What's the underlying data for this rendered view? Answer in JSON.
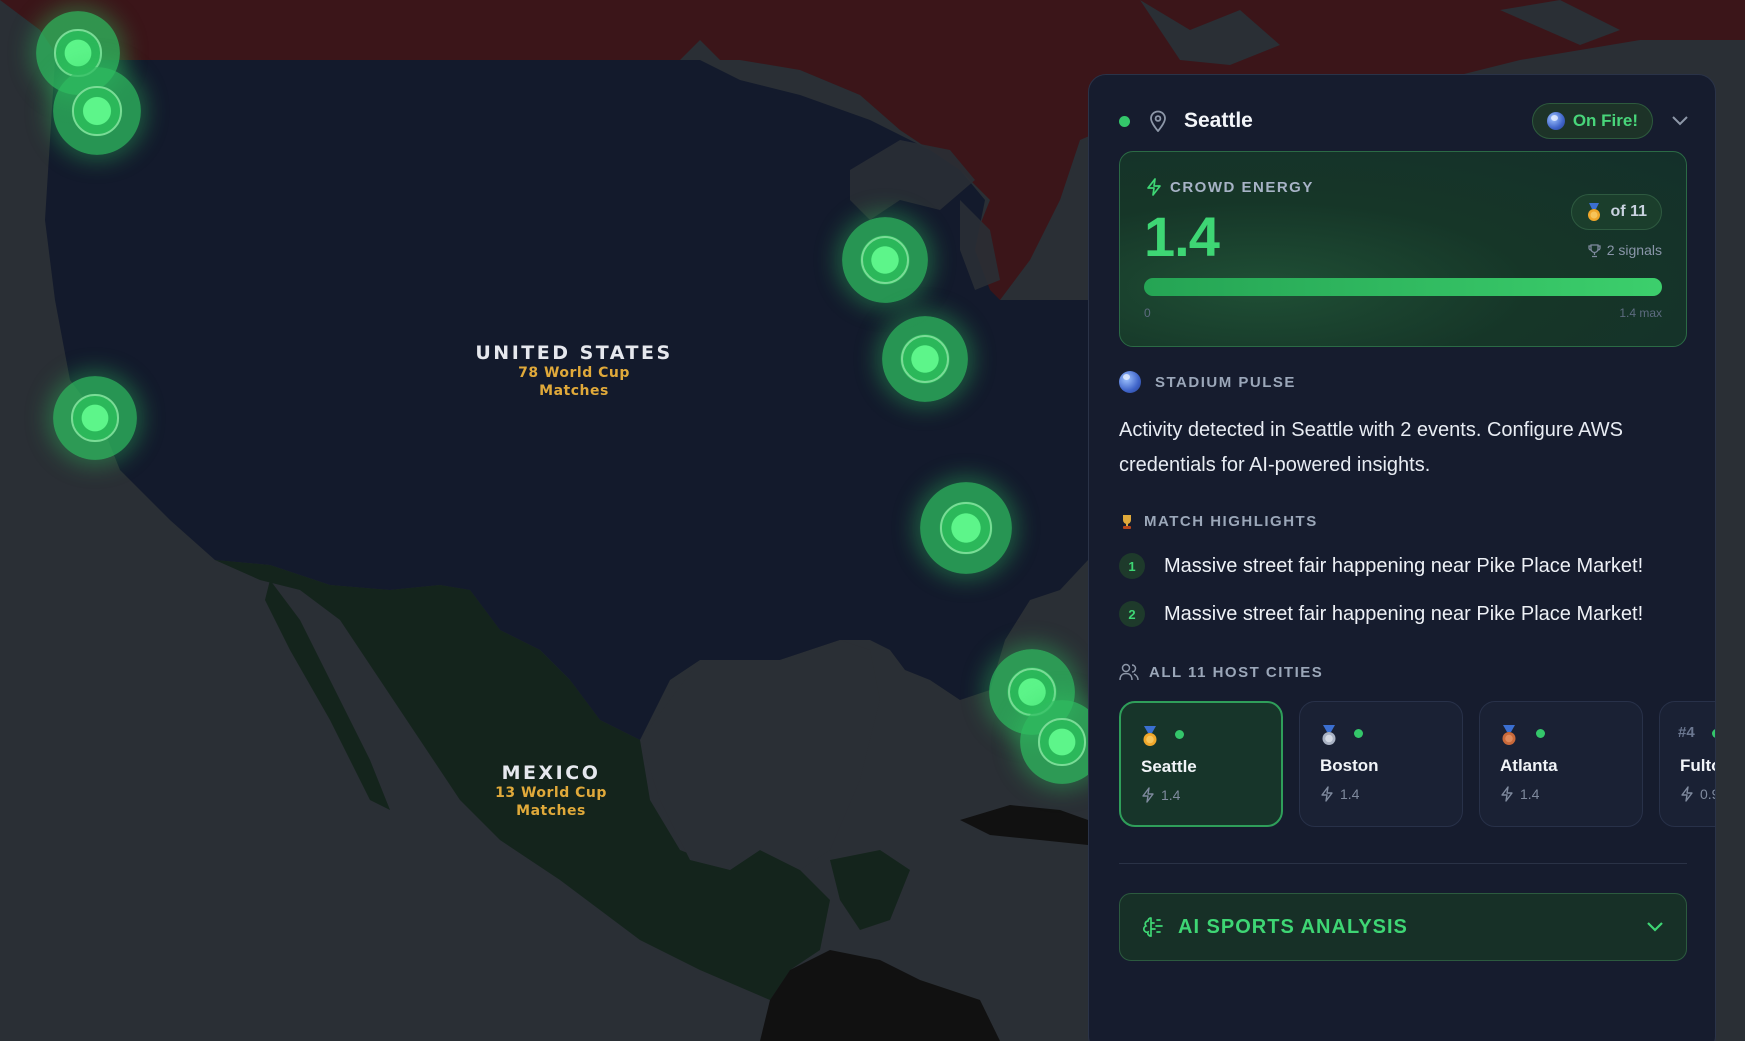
{
  "map": {
    "labels": [
      {
        "country": "UNITED STATES",
        "matches": "78 World Cup",
        "matches2": "Matches"
      },
      {
        "country": "MEXICO",
        "matches": "13 World Cup",
        "matches2": "Matches"
      }
    ],
    "colors": {
      "ocean": "#2a2f35",
      "canada": "#3b1519",
      "usa": "#131a2c",
      "mexico": "#14241c",
      "caribbean": "#111111",
      "hotspot": "#3ed674"
    }
  },
  "panel": {
    "city": "Seattle",
    "status": "On Fire!",
    "energy": {
      "label": "CROWD ENERGY",
      "value": "1.4",
      "rank": "of 11",
      "signals": "2 signals",
      "bar_fraction": 1.0,
      "min": "0",
      "max": "1.4 max"
    },
    "pulse": {
      "title": "STADIUM PULSE",
      "text": "Activity detected in Seattle with 2 events. Configure AWS credentials for AI-powered insights."
    },
    "highlights": {
      "title": "MATCH HIGHLIGHTS",
      "items": [
        {
          "num": "1",
          "text": "Massive street fair happening near Pike Place Market!"
        },
        {
          "num": "2",
          "text": "Massive street fair happening near Pike Place Market!"
        }
      ]
    },
    "cities": {
      "title": "ALL 11 HOST CITIES",
      "items": [
        {
          "name": "Seattle",
          "value": "1.4",
          "medal": "gold"
        },
        {
          "name": "Boston",
          "value": "1.4",
          "medal": "silver"
        },
        {
          "name": "Atlanta",
          "value": "1.4",
          "medal": "bronze"
        },
        {
          "rank": "#4",
          "name": "Fulto",
          "value": "0.9"
        }
      ]
    },
    "ai": {
      "label": "AI SPORTS ANALYSIS"
    }
  }
}
